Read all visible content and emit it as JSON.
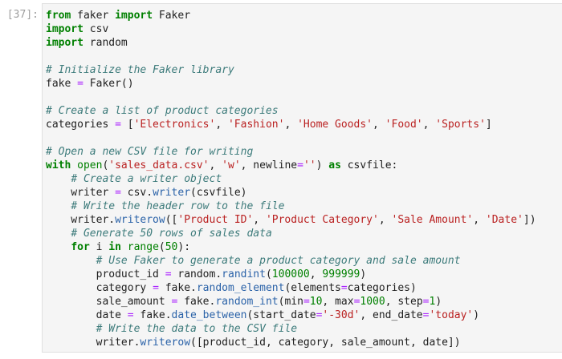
{
  "cell": {
    "prompt": "[37]:",
    "lines": [
      [
        [
          "k",
          "from"
        ],
        [
          "t",
          " faker "
        ],
        [
          "k",
          "import"
        ],
        [
          "t",
          " Faker"
        ]
      ],
      [
        [
          "k",
          "import"
        ],
        [
          "t",
          " csv"
        ]
      ],
      [
        [
          "k",
          "import"
        ],
        [
          "t",
          " random"
        ]
      ],
      [],
      [
        [
          "c",
          "# Initialize the Faker library"
        ]
      ],
      [
        [
          "t",
          "fake "
        ],
        [
          "o",
          "="
        ],
        [
          "t",
          " Faker()"
        ]
      ],
      [],
      [
        [
          "c",
          "# Create a list of product categories"
        ]
      ],
      [
        [
          "t",
          "categories "
        ],
        [
          "o",
          "="
        ],
        [
          "t",
          " ["
        ],
        [
          "s",
          "'Electronics'"
        ],
        [
          "t",
          ", "
        ],
        [
          "s",
          "'Fashion'"
        ],
        [
          "t",
          ", "
        ],
        [
          "s",
          "'Home Goods'"
        ],
        [
          "t",
          ", "
        ],
        [
          "s",
          "'Food'"
        ],
        [
          "t",
          ", "
        ],
        [
          "s",
          "'Sports'"
        ],
        [
          "t",
          "]"
        ]
      ],
      [],
      [
        [
          "c",
          "# Open a new CSV file for writing"
        ]
      ],
      [
        [
          "k",
          "with"
        ],
        [
          "t",
          " "
        ],
        [
          "b",
          "open"
        ],
        [
          "t",
          "("
        ],
        [
          "s",
          "'sales_data.csv'"
        ],
        [
          "t",
          ", "
        ],
        [
          "s",
          "'w'"
        ],
        [
          "t",
          ", newline"
        ],
        [
          "o",
          "="
        ],
        [
          "s",
          "''"
        ],
        [
          "t",
          ") "
        ],
        [
          "k",
          "as"
        ],
        [
          "t",
          " csvfile:"
        ]
      ],
      [
        [
          "t",
          "    "
        ],
        [
          "c",
          "# Create a writer object"
        ]
      ],
      [
        [
          "t",
          "    writer "
        ],
        [
          "o",
          "="
        ],
        [
          "t",
          " csv."
        ],
        [
          "p",
          "writer"
        ],
        [
          "t",
          "(csvfile)"
        ]
      ],
      [
        [
          "t",
          "    "
        ],
        [
          "c",
          "# Write the header row to the file"
        ]
      ],
      [
        [
          "t",
          "    writer."
        ],
        [
          "p",
          "writerow"
        ],
        [
          "t",
          "(["
        ],
        [
          "s",
          "'Product ID'"
        ],
        [
          "t",
          ", "
        ],
        [
          "s",
          "'Product Category'"
        ],
        [
          "t",
          ", "
        ],
        [
          "s",
          "'Sale Amount'"
        ],
        [
          "t",
          ", "
        ],
        [
          "s",
          "'Date'"
        ],
        [
          "t",
          "])"
        ]
      ],
      [
        [
          "t",
          "    "
        ],
        [
          "c",
          "# Generate 50 rows of sales data"
        ]
      ],
      [
        [
          "t",
          "    "
        ],
        [
          "k",
          "for"
        ],
        [
          "t",
          " i "
        ],
        [
          "k",
          "in"
        ],
        [
          "t",
          " "
        ],
        [
          "b",
          "range"
        ],
        [
          "t",
          "("
        ],
        [
          "n",
          "50"
        ],
        [
          "t",
          "):"
        ]
      ],
      [
        [
          "t",
          "        "
        ],
        [
          "c",
          "# Use Faker to generate a product category and sale amount"
        ]
      ],
      [
        [
          "t",
          "        product_id "
        ],
        [
          "o",
          "="
        ],
        [
          "t",
          " random."
        ],
        [
          "p",
          "randint"
        ],
        [
          "t",
          "("
        ],
        [
          "n",
          "100000"
        ],
        [
          "t",
          ", "
        ],
        [
          "n",
          "999999"
        ],
        [
          "t",
          ")"
        ]
      ],
      [
        [
          "t",
          "        category "
        ],
        [
          "o",
          "="
        ],
        [
          "t",
          " fake."
        ],
        [
          "p",
          "random_element"
        ],
        [
          "t",
          "(elements"
        ],
        [
          "o",
          "="
        ],
        [
          "t",
          "categories)"
        ]
      ],
      [
        [
          "t",
          "        sale_amount "
        ],
        [
          "o",
          "="
        ],
        [
          "t",
          " fake."
        ],
        [
          "p",
          "random_int"
        ],
        [
          "t",
          "(min"
        ],
        [
          "o",
          "="
        ],
        [
          "n",
          "10"
        ],
        [
          "t",
          ", max"
        ],
        [
          "o",
          "="
        ],
        [
          "n",
          "1000"
        ],
        [
          "t",
          ", step"
        ],
        [
          "o",
          "="
        ],
        [
          "n",
          "1"
        ],
        [
          "t",
          ")"
        ]
      ],
      [
        [
          "t",
          "        date "
        ],
        [
          "o",
          "="
        ],
        [
          "t",
          " fake."
        ],
        [
          "p",
          "date_between"
        ],
        [
          "t",
          "(start_date"
        ],
        [
          "o",
          "="
        ],
        [
          "s",
          "'-30d'"
        ],
        [
          "t",
          ", end_date"
        ],
        [
          "o",
          "="
        ],
        [
          "s",
          "'today'"
        ],
        [
          "t",
          ")"
        ]
      ],
      [
        [
          "t",
          "        "
        ],
        [
          "c",
          "# Write the data to the CSV file"
        ]
      ],
      [
        [
          "t",
          "        writer."
        ],
        [
          "p",
          "writerow"
        ],
        [
          "t",
          "([product_id, category, sale_amount, date])"
        ]
      ]
    ]
  }
}
